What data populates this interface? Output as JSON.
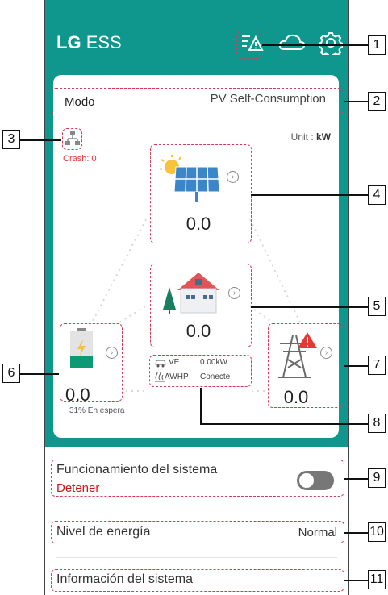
{
  "header": {
    "logo_lg": "LG",
    "logo_ess": "ESS",
    "icons": [
      "list-alert-icon",
      "cloud-icon",
      "gear-icon"
    ]
  },
  "mode": {
    "label": "Modo",
    "value": "PV Self-Consumption"
  },
  "unit": {
    "label": "Unit : ",
    "value": "kW"
  },
  "network": {
    "crash": "Crash: 0"
  },
  "pv": {
    "value": "0.0"
  },
  "load": {
    "value": "0.0"
  },
  "battery": {
    "value": "0.0",
    "status": "31% En espera"
  },
  "grid": {
    "value": "0.0"
  },
  "ev": {
    "ve_label": "VE",
    "ve_value": "0.00kW",
    "awhp_label": "AWHP",
    "awhp_value": "Conecte"
  },
  "system": {
    "label": "Funcionamiento del sistema",
    "status": "Detener"
  },
  "energy": {
    "label": "Nivel de energía",
    "value": "Normal"
  },
  "info": {
    "label": "Información del sistema"
  },
  "callouts": [
    "1",
    "2",
    "3",
    "4",
    "5",
    "6",
    "7",
    "8",
    "9",
    "10",
    "11"
  ],
  "colors": {
    "teal": "#10978d",
    "dash": "#d23a55",
    "alert": "#d0141c"
  }
}
